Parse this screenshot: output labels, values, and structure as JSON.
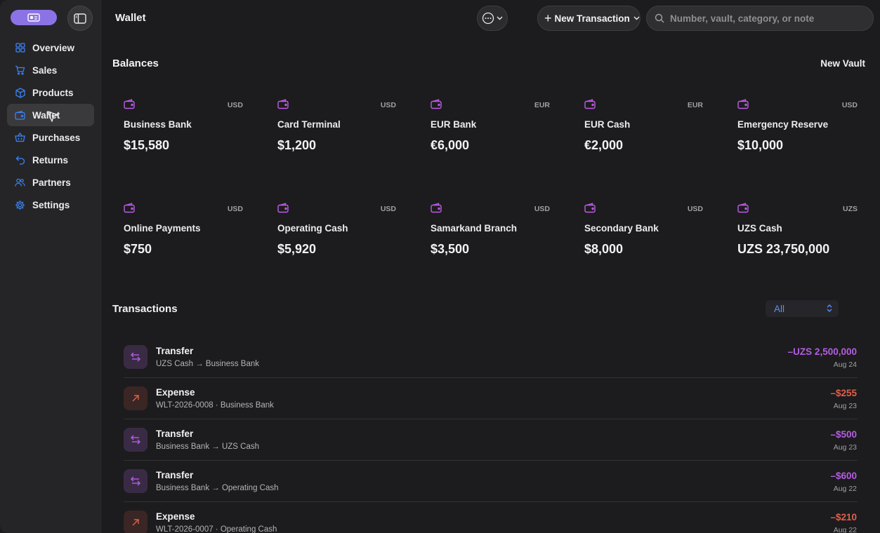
{
  "sidebar": {
    "items": [
      {
        "label": "Overview",
        "icon": "grid-icon",
        "active": false
      },
      {
        "label": "Sales",
        "icon": "cart-icon",
        "active": false
      },
      {
        "label": "Products",
        "icon": "box-icon",
        "active": false
      },
      {
        "label": "Wallet",
        "icon": "wallet-icon",
        "active": true
      },
      {
        "label": "Purchases",
        "icon": "basket-icon",
        "active": false
      },
      {
        "label": "Returns",
        "icon": "return-arrow-icon",
        "active": false
      },
      {
        "label": "Partners",
        "icon": "people-icon",
        "active": false
      },
      {
        "label": "Settings",
        "icon": "gear-icon",
        "active": false
      }
    ]
  },
  "header": {
    "title": "Wallet",
    "new_transaction_label": "New Transaction",
    "search_placeholder": "Number, vault, category, or note"
  },
  "balances": {
    "title": "Balances",
    "new_vault_label": "New Vault",
    "vaults": [
      {
        "name": "Business Bank",
        "currency": "USD",
        "amount": "$15,580"
      },
      {
        "name": "Card Terminal",
        "currency": "USD",
        "amount": "$1,200"
      },
      {
        "name": "EUR Bank",
        "currency": "EUR",
        "amount": "€6,000"
      },
      {
        "name": "EUR Cash",
        "currency": "EUR",
        "amount": "€2,000"
      },
      {
        "name": "Emergency Reserve",
        "currency": "USD",
        "amount": "$10,000"
      },
      {
        "name": "Online Payments",
        "currency": "USD",
        "amount": "$750"
      },
      {
        "name": "Operating Cash",
        "currency": "USD",
        "amount": "$5,920"
      },
      {
        "name": "Samarkand Branch",
        "currency": "USD",
        "amount": "$3,500"
      },
      {
        "name": "Secondary Bank",
        "currency": "USD",
        "amount": "$8,000"
      },
      {
        "name": "UZS Cash",
        "currency": "UZS",
        "amount": "UZS 23,750,000"
      }
    ]
  },
  "transactions": {
    "title": "Transactions",
    "filter_value": "All",
    "rows": [
      {
        "type": "Transfer",
        "kind": "transfer",
        "sub": "UZS Cash → Business Bank",
        "amount": "–UZS 2,500,000",
        "date": "Aug 24"
      },
      {
        "type": "Expense",
        "kind": "expense",
        "sub": "WLT-2026-0008 · Business Bank",
        "amount": "–$255",
        "date": "Aug 23"
      },
      {
        "type": "Transfer",
        "kind": "transfer",
        "sub": "Business Bank → UZS Cash",
        "amount": "–$500",
        "date": "Aug 23"
      },
      {
        "type": "Transfer",
        "kind": "transfer",
        "sub": "Business Bank → Operating Cash",
        "amount": "–$600",
        "date": "Aug 22"
      },
      {
        "type": "Expense",
        "kind": "expense",
        "sub": "WLT-2026-0007 · Operating Cash",
        "amount": "–$210",
        "date": "Aug 22"
      }
    ]
  },
  "colors": {
    "accent": "#8b73e6",
    "transfer": "#b45ee0",
    "expense": "#e0604a",
    "nav_icon": "#3b82f6",
    "filter_text": "#5b8ff9"
  }
}
